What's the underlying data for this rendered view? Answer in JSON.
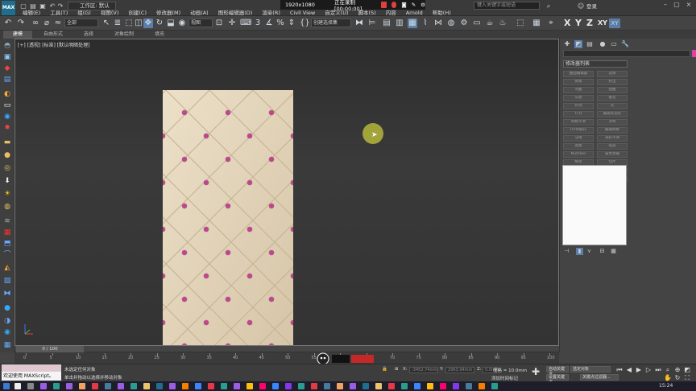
{
  "app": {
    "logo": "MAX",
    "workspace_label": "工作区: 默认"
  },
  "menu": [
    "编辑(E)",
    "工具(T)",
    "组(G)",
    "视图(V)",
    "创建(C)",
    "修改器(M)",
    "动画(A)",
    "图形编辑器(D)",
    "渲染(R)",
    "Civil View",
    "自定义(U)",
    "脚本(S)",
    "内容",
    "Arnold",
    "帮助(H)"
  ],
  "recording": {
    "resolution": "1920x1080",
    "status": "正在录制 [00:00:00]"
  },
  "search": {
    "placeholder": "键入关键字或短语"
  },
  "account": {
    "login_label": "登录"
  },
  "toolbar": {
    "filter_dropdown": "全部",
    "view_dropdown": "视图",
    "selection_set_dropdown": "创建选择集",
    "axis_labels": [
      "X",
      "Y",
      "Z",
      "XY"
    ]
  },
  "ribbon": {
    "tabs": [
      "建模",
      "自由形式",
      "选择",
      "对象绘制",
      "填充"
    ],
    "active_tab": "建模"
  },
  "viewport": {
    "label": "[+] [透视] [标准] [默认明暗处理]"
  },
  "command_panel": {
    "modifier_list_label": "修改器列表",
    "modifier_buttons": [
      "曲面编辑器",
      "选择",
      "倒角",
      "挤出",
      "弯曲",
      "扭曲",
      "车削",
      "锥化",
      "补洞",
      "壳",
      "FFD",
      "编辑多边形",
      "网格平滑",
      "对称",
      "UVW展开",
      "编辑网格",
      "法线",
      "涡轮平滑",
      "晶格",
      "噪波",
      "MultiRes",
      "属性承载",
      "细化",
      "切片",
      "路径变形",
      "平滑",
      "FFD 4x4x4",
      "编辑样条线"
    ]
  },
  "timeline": {
    "frame_display": "0 / 100",
    "ticks": [
      0,
      5,
      10,
      15,
      20,
      25,
      30,
      35,
      40,
      45,
      50,
      55,
      60,
      65,
      70,
      75,
      80,
      85,
      90,
      95,
      100
    ]
  },
  "status": {
    "maxscript_label": "欢迎使用 MAXScript。",
    "status_line1": "未选定任何对象",
    "status_line2": "单击并拖动以选择并移动对象",
    "x_label": "X:",
    "x_value": "-3452.74mm",
    "y_label": "Y:",
    "y_value": "2963.94mm",
    "z_label": "Z:",
    "z_value": "0.0mm",
    "grid_label": "栅格 = 10.0mm",
    "add_time_tag": "添加时间标记",
    "auto_key": "自动关键点",
    "selected_object": "选定对象",
    "set_key": "设置关键点",
    "key_filter": "关键点过滤器..."
  },
  "watermark": {
    "text": "达 百 科"
  },
  "taskbar": {
    "clock": "15:24"
  }
}
